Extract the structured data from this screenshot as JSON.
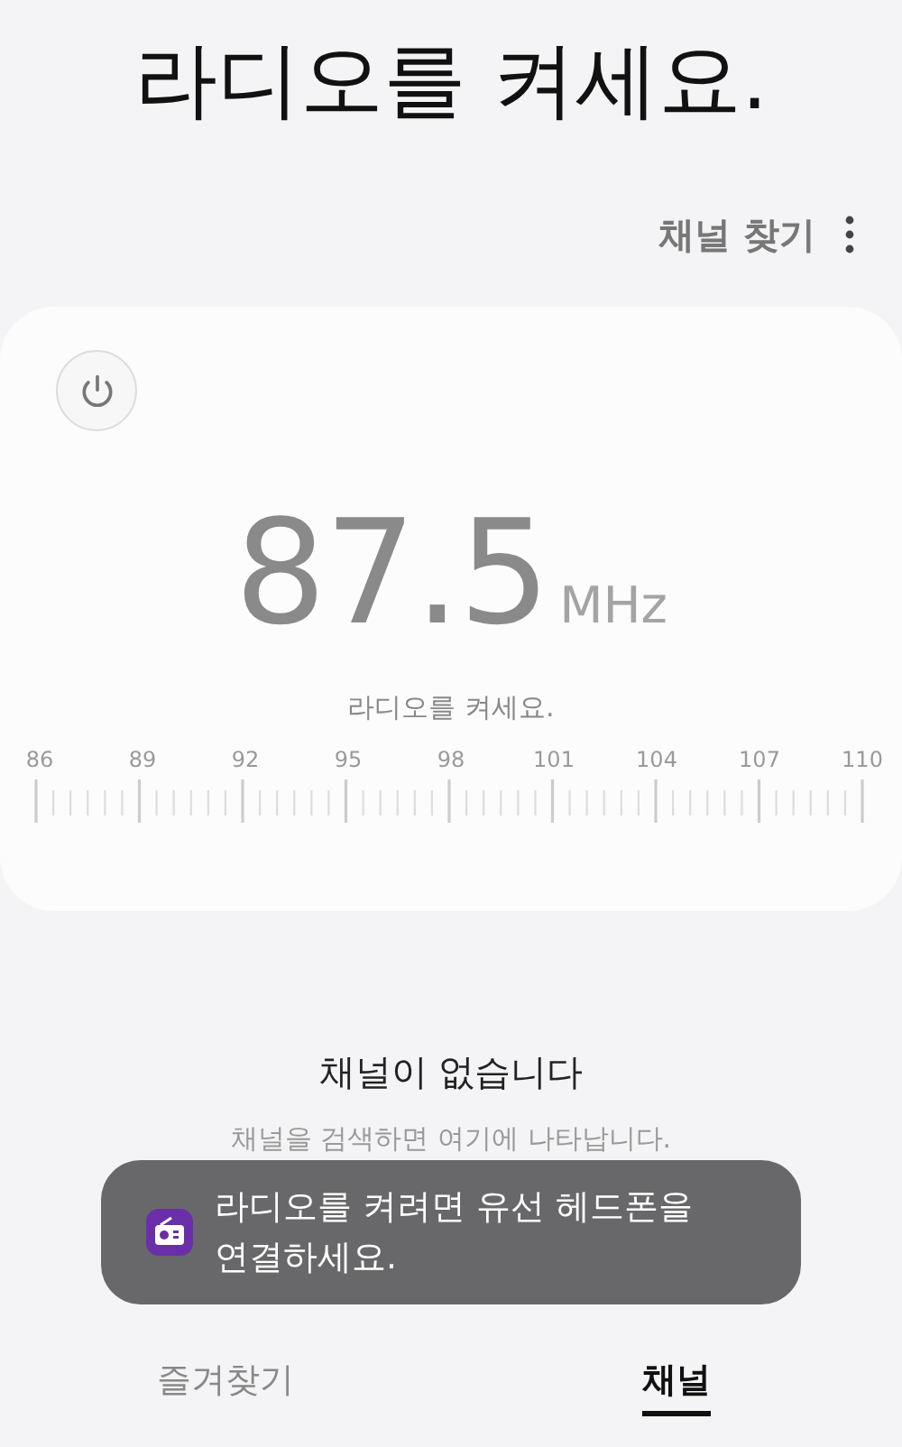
{
  "title": "라디오를 켜세요.",
  "search_button": "채널 찾기",
  "card": {
    "power_on": false,
    "frequency": "87.5",
    "unit": "MHz",
    "status": "라디오를 켜세요.",
    "scale_labels": [
      "86",
      "89",
      "92",
      "95",
      "98",
      "101",
      "104",
      "107",
      "110"
    ]
  },
  "empty": {
    "title": "채널이 없습니다",
    "hint": "채널을 검색하면 여기에 나타납니다."
  },
  "toast": {
    "message": "라디오를 켜려면 유선 헤드폰을 연결하세요."
  },
  "tabs": [
    {
      "label": "즐겨찾기",
      "selected": false
    },
    {
      "label": "채널",
      "selected": true
    }
  ]
}
